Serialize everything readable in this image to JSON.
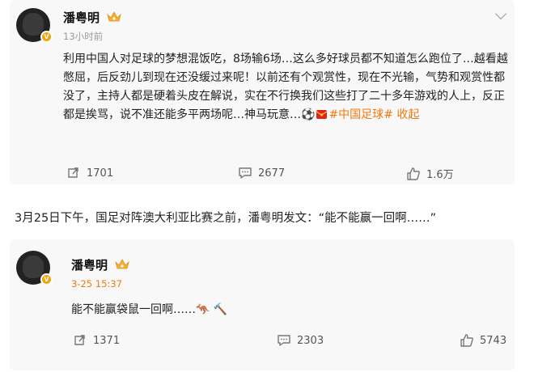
{
  "post1": {
    "author": "潘粤明",
    "time": "13小时前",
    "content": "利用中国人对足球的梦想混饭吃，8场输6场…这么多好球员都不知道怎么跑位了…越看越憋屈，后反劲儿到现在还没缓过来呢！以前还有个观赏性，现在不光输，气势和观赏性都没了，主持人都是硬着头皮在解说，实在不行换我们这些打了二十多年游戏的人上，反正都是挨骂，说不准还能多平两场呢…神马玩意…",
    "emoji": "⚽",
    "tag": "#中国足球#",
    "fold": "收起",
    "reposts": "1701",
    "comments": "2677",
    "likes": "1.6万"
  },
  "caption": "3月25日下午，国足对阵澳大利亚比赛之前，潘粤明发文：“能不能赢一回啊……”",
  "post2": {
    "author": "潘粤明",
    "time": "3-25 15:37",
    "content": "能不能赢袋鼠一回啊……",
    "emoji1": "🦘",
    "emoji2": "🔨",
    "reposts": "1371",
    "comments": "2303",
    "likes": "5743"
  },
  "colors": {
    "accent": "#f07a11",
    "badge": "#f3a20b",
    "card": "#f8f8f8"
  },
  "icons": [
    "verified-v-icon",
    "crown-icon",
    "chevron-down-icon",
    "repost-icon",
    "comment-icon",
    "like-icon",
    "red-envelope-icon"
  ]
}
